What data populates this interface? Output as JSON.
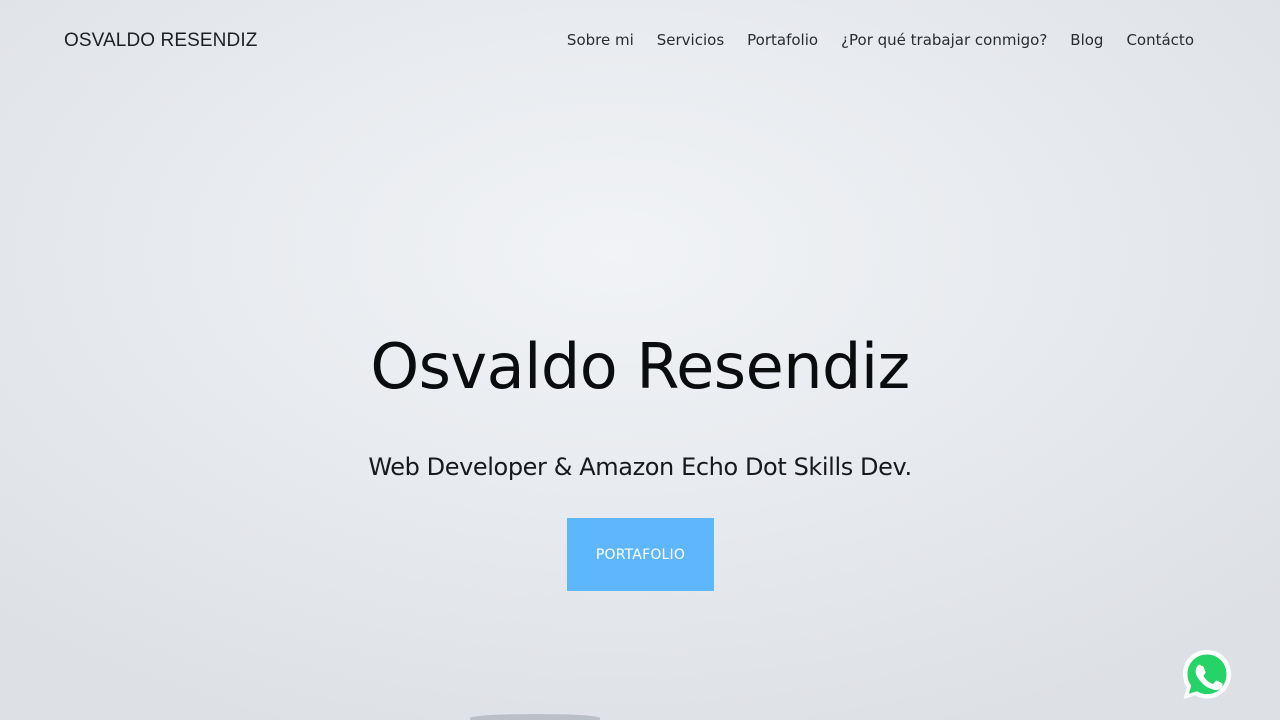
{
  "header": {
    "brand": "OSVALDO RESENDIZ",
    "nav": [
      {
        "label": "Sobre mi"
      },
      {
        "label": "Servicios"
      },
      {
        "label": "Portafolio"
      },
      {
        "label": "¿Por qué trabajar conmigo?"
      },
      {
        "label": "Blog"
      },
      {
        "label": "Contácto"
      }
    ]
  },
  "hero": {
    "title": "Osvaldo Resendiz",
    "subtitle": "Web Developer & Amazon Echo Dot Skills Dev.",
    "cta_label": "PORTAFOLIO"
  },
  "floating": {
    "icon": "whatsapp-icon"
  },
  "colors": {
    "accent": "#5eb6fc",
    "whatsapp": "#25d366",
    "text": "#0b0c0e"
  }
}
